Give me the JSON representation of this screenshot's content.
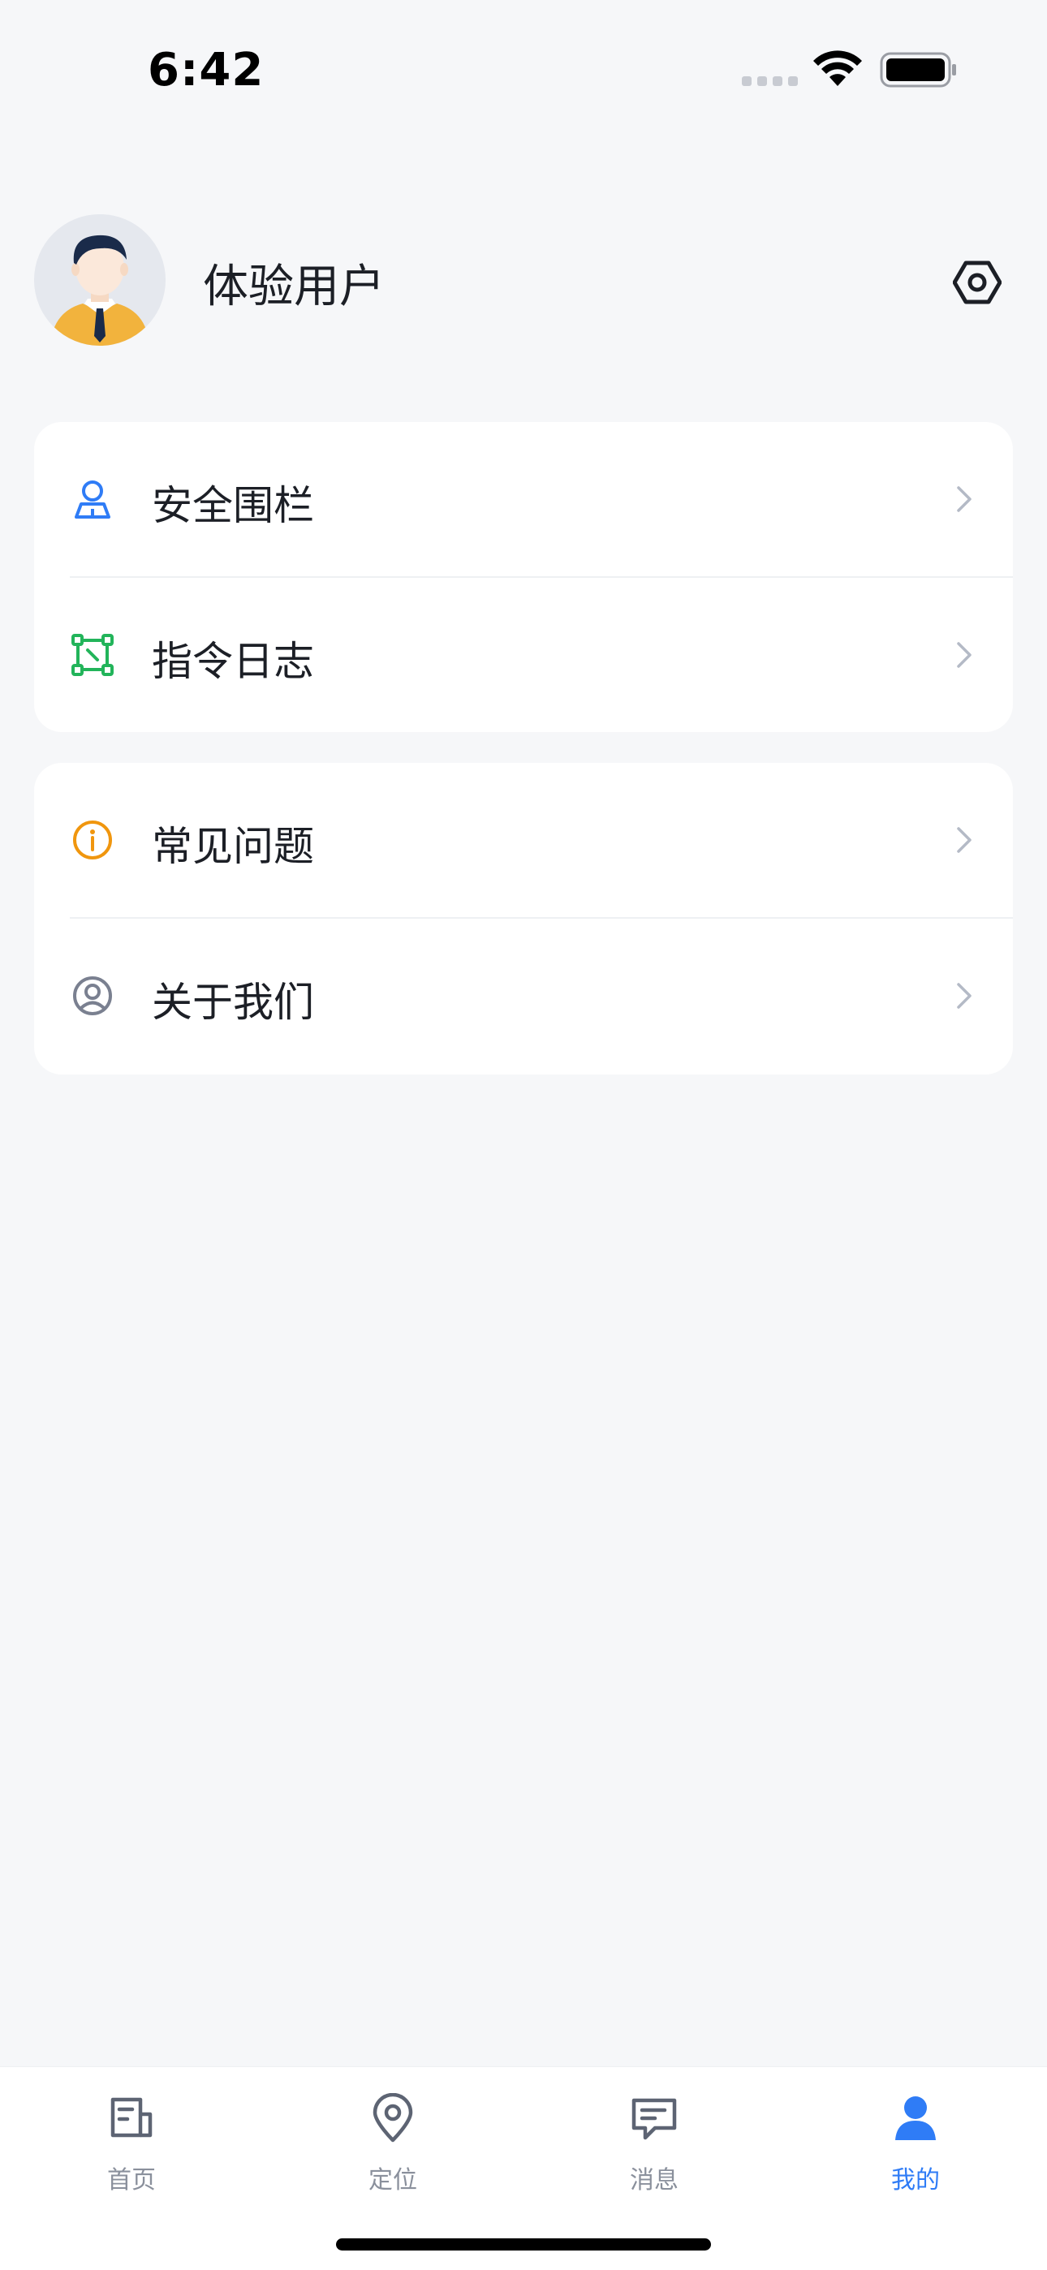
{
  "status_bar": {
    "time": "6:42"
  },
  "profile": {
    "user_name": "体验用户"
  },
  "menu_group_1": [
    {
      "label": "安全围栏",
      "icon": "user-fence-icon",
      "color": "#2F7CF6"
    },
    {
      "label": "指令日志",
      "icon": "command-log-icon",
      "color": "#22B45A"
    }
  ],
  "menu_group_2": [
    {
      "label": "常见问题",
      "icon": "info-circle-icon",
      "color": "#F0960E"
    },
    {
      "label": "关于我们",
      "icon": "user-circle-icon",
      "color": "#7A8090"
    }
  ],
  "tab_bar": {
    "tabs": [
      {
        "label": "首页",
        "icon": "document-icon",
        "active": false
      },
      {
        "label": "定位",
        "icon": "location-pin-icon",
        "active": false
      },
      {
        "label": "消息",
        "icon": "message-icon",
        "active": false
      },
      {
        "label": "我的",
        "icon": "person-icon",
        "active": true
      }
    ],
    "active_color": "#2F7CF6",
    "inactive_color": "#8A909C"
  }
}
